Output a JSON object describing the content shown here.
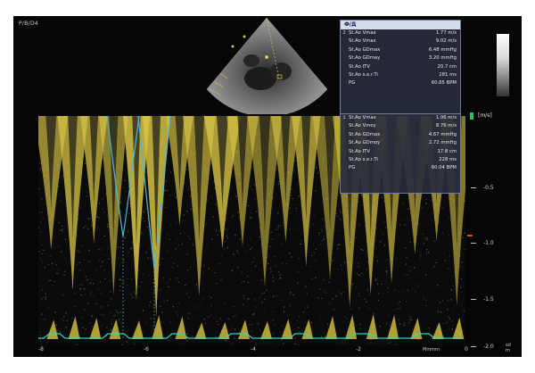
{
  "screen": {
    "mode_label": "P/B/D4"
  },
  "measurements": {
    "header_title": "Ф/Д",
    "panel_1": {
      "index": "2",
      "rows": [
        {
          "label": "St.Ao Vmax",
          "value": "1.77 m/s"
        },
        {
          "label": "St.Ao Vmax",
          "value": "9.02 m/s"
        },
        {
          "label": "St.Ao GDmax",
          "value": "6.48 mmHg"
        },
        {
          "label": "St.Ao GDmay",
          "value": "3.20 mmHg"
        },
        {
          "label": "St.Ao ITV",
          "value": "20.7 cm"
        },
        {
          "label": "St.Ao s.e.r.Ti",
          "value": "281 ms"
        },
        {
          "label": "PG",
          "value": "60.85 BPM"
        }
      ]
    },
    "panel_2": {
      "index": "1",
      "rows": [
        {
          "label": "St.Ao Vmax",
          "value": "1.06 m/s"
        },
        {
          "label": "St.Ao Vmoy",
          "value": "8.76 m/s"
        },
        {
          "label": "St.Ao GDmax",
          "value": "4.67 mmHg"
        },
        {
          "label": "St.Ao GDmoy",
          "value": "2.72 mmHg"
        },
        {
          "label": "St.Ao ITV",
          "value": "17.8 cm"
        },
        {
          "label": "St.Ao s.e.r.Ti",
          "value": "228 ms"
        },
        {
          "label": "PG",
          "value": "60.04 BPM"
        }
      ]
    }
  },
  "scale": {
    "unit": "[m/s]",
    "labels": [
      "-0.5",
      "-1.0",
      "-1.5",
      "-2.0"
    ]
  },
  "time_axis": {
    "labels": [
      "-8",
      "-6",
      "-4",
      "-2",
      "0"
    ],
    "speed_text": "Mmmm",
    "corner_text": [
      "sd",
      "m"
    ]
  },
  "colors": {
    "doppler": "#d8c445",
    "trace": "#4fb7d6",
    "baseline": "#2dd4bf",
    "badge": "#22c55e"
  }
}
